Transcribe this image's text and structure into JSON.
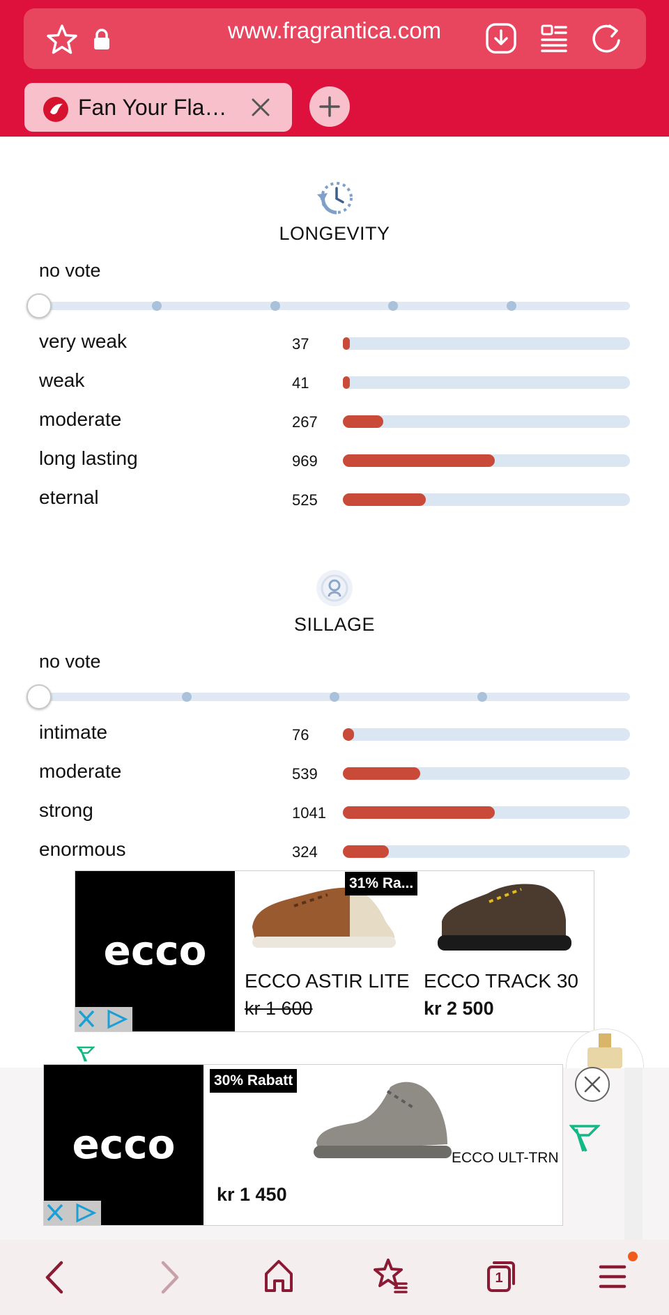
{
  "browser": {
    "url": "www.fragrantica.com",
    "tab_title": "Fan Your Fla…",
    "tab_favicon": "fragrantica-bird-icon",
    "icons": [
      "star-icon",
      "lock-icon",
      "download-icon",
      "reader-mode-icon",
      "reload-icon",
      "close-icon",
      "plus-icon"
    ]
  },
  "longevity": {
    "title": "LONGEVITY",
    "vote_label": "no vote",
    "rows": [
      {
        "label": "very weak",
        "count": "37",
        "fraction": 0.02
      },
      {
        "label": "weak",
        "count": "41",
        "fraction": 0.02
      },
      {
        "label": "moderate",
        "count": "267",
        "fraction": 0.14
      },
      {
        "label": "long lasting",
        "count": "969",
        "fraction": 0.53
      },
      {
        "label": "eternal",
        "count": "525",
        "fraction": 0.29
      }
    ]
  },
  "sillage": {
    "title": "SILLAGE",
    "vote_label": "no vote",
    "rows": [
      {
        "label": "intimate",
        "count": "76",
        "fraction": 0.04
      },
      {
        "label": "moderate",
        "count": "539",
        "fraction": 0.27
      },
      {
        "label": "strong",
        "count": "1041",
        "fraction": 0.53
      },
      {
        "label": "enormous",
        "count": "324",
        "fraction": 0.16
      }
    ]
  },
  "ad1": {
    "brand": "ecco",
    "discount": "31% Ra...",
    "product1_name": "ECCO ASTIR LITE",
    "product1_price": "kr 1 600",
    "product2_name": "ECCO TRACK 30",
    "product2_price": "kr 2 500"
  },
  "ad2": {
    "brand": "ecco",
    "discount": "30% Rabatt",
    "product_name": "ECCO ULT-TRN",
    "product_price": "kr 1 450"
  },
  "bottom_nav": {
    "tab_count": "1",
    "icons": [
      "back-icon",
      "forward-icon",
      "home-icon",
      "favorites-icon",
      "tabs-icon",
      "menu-icon"
    ]
  },
  "colors": {
    "brand_red": "#de103c",
    "bar_fill": "#c94a39",
    "bar_track": "#dbe6f3"
  }
}
